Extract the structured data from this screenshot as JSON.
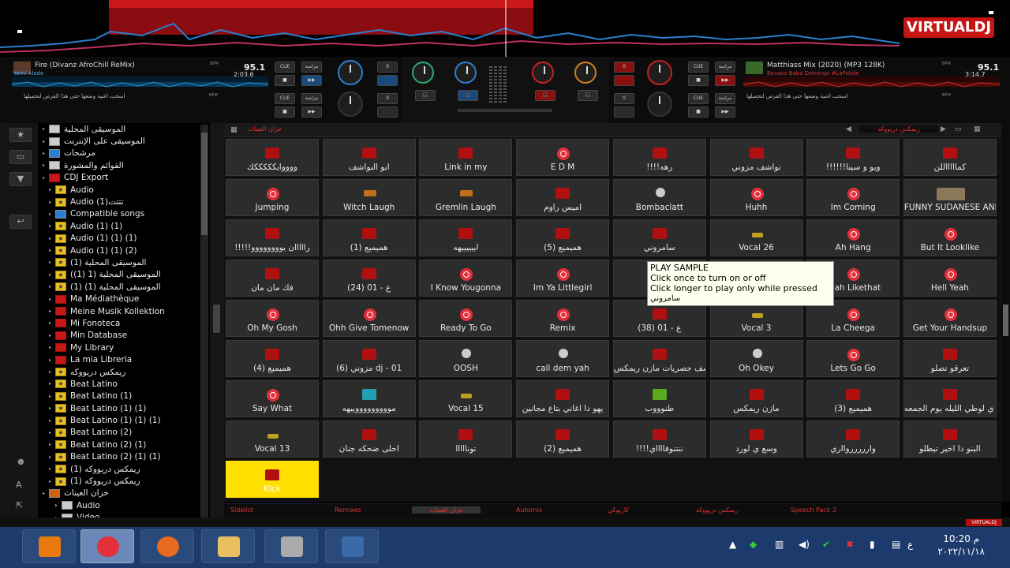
{
  "app": {
    "logo": "VIRTUALDJ",
    "logo_small": "VIRTUALDJ"
  },
  "deck_left": {
    "title": "Fire (Divanz AfroChill ReMix)",
    "artist": "Yemi Alade",
    "bpm": "95.1",
    "time": "2:03.6",
    "next_hint": "اسحب اغنية وضعها حتى هذا القرص لتحميلها",
    "bpm_label": "BPM"
  },
  "deck_right": {
    "title": "Matthiass Mix (2020) (MP3 128K)",
    "artist": "Bevaso Baba Domingo #LaPolide",
    "bpm": "95.1",
    "time": "3:14.7",
    "next_hint": "اسحب اغنية وضعها حتى هذا القرص لتحميلها",
    "bpm_label": "BPM"
  },
  "controls": {
    "cue": "CUE",
    "sync": "مزامنة",
    "pitch": "0"
  },
  "sidebar": {
    "items": [
      {
        "label": "الموسيقى المحلية",
        "icon": "gray"
      },
      {
        "label": "الموسيقى على الإنترنت",
        "icon": "gray"
      },
      {
        "label": "مرشحات",
        "icon": "blue"
      },
      {
        "label": "القوائم والمشورة",
        "icon": "gray"
      },
      {
        "label": "CDJ Export",
        "icon": "red"
      },
      {
        "label": "Audio",
        "icon": "star"
      },
      {
        "label": "Audio (1)تتتت",
        "icon": "star"
      },
      {
        "label": "Compatible songs",
        "icon": "blue"
      },
      {
        "label": "Audio (1) (1)",
        "icon": "star"
      },
      {
        "label": "Audio (1) (1) (1)",
        "icon": "star"
      },
      {
        "label": "Audio (1) (1) (2)",
        "icon": "star"
      },
      {
        "label": "(1) الموسيقى المحلية",
        "icon": "star"
      },
      {
        "label": "(الموسيقى المحلية (1 (1)",
        "icon": "star"
      },
      {
        "label": "(الموسيقى المحلية (1) (1",
        "icon": "star"
      },
      {
        "label": "Ma Médiathèque",
        "icon": "red"
      },
      {
        "label": "Meine Musik Kollektion",
        "icon": "red"
      },
      {
        "label": "Mi Fonoteca",
        "icon": "red"
      },
      {
        "label": "Min Database",
        "icon": "red"
      },
      {
        "label": "My Library",
        "icon": "red"
      },
      {
        "label": "La mia Libreria",
        "icon": "red"
      },
      {
        "label": "ريمكس دريووكه",
        "icon": "star"
      },
      {
        "label": "Beat Latino",
        "icon": "star"
      },
      {
        "label": "Beat Latino (1)",
        "icon": "star"
      },
      {
        "label": "Beat Latino (1) (1)",
        "icon": "star"
      },
      {
        "label": "Beat Latino (1) (1) (1)",
        "icon": "star"
      },
      {
        "label": "Beat Latino (2)",
        "icon": "star"
      },
      {
        "label": "Beat Latino (2) (1)",
        "icon": "star"
      },
      {
        "label": "Beat Latino (2) (1) (1)",
        "icon": "star"
      },
      {
        "label": "(1) ريمكس دريووكه",
        "icon": "star"
      },
      {
        "label": "(ريمكس دريووكه (1",
        "icon": "star"
      },
      {
        "label": "خزان العينات",
        "icon": "orange"
      },
      {
        "label": "Audio",
        "icon": "gray"
      },
      {
        "label": "Video",
        "icon": "gray"
      }
    ]
  },
  "sampler": {
    "header_title": "خزان العينات",
    "folder": "ريمكس دريووكه",
    "pads": [
      [
        "ووووايكككككك",
        "ابو النواشف",
        "Link in my",
        "E D M",
        "!!!!رهه",
        "نواشف مزوني",
        "!!!!!!ويو و سينا",
        "كماااااللن"
      ],
      [
        "Jumping",
        "Witch Laugh",
        "Gremlin Laugh",
        "اميس راوم",
        "Bombaclatt",
        "Huhh",
        "Im Coming",
        "FUNNY SUDANESE ANIMA..."
      ],
      [
        "!!!!!رااااان يوووووووو",
        "(1) هميميع",
        "اييييييهه",
        "(5) هميميع",
        "سامروني",
        "Vocal 26",
        "Ah Hang",
        "But It Looklike"
      ],
      [
        "فك مان مان",
        "(24) ع - 01",
        "I Know Yougonna",
        "Im Ya Littlegirl",
        "",
        "",
        "Yeah Likethat",
        "Hell Yeah"
      ],
      [
        "Oh My Gosh",
        "Ohh Give Tomenow",
        "Ready To Go",
        "Remix",
        "(38) ع - 01",
        "Vocal 3",
        "La Cheega",
        "Get Your Handsup"
      ],
      [
        "(4) هميميع",
        "(6) مزوني dj - 01",
        "OOSH",
        "call dem yah",
        "نواشف حصريات مازن ريمكس",
        "Oh Okey",
        "Lets Go Go",
        "تعرقو تصلو"
      ],
      [
        "Say What",
        "موووووووووييهه",
        "Vocal 15",
        "يهو دا اغاني بتاع مجانين",
        "طنوووب",
        "مازن ريمكس",
        "(3) هميميع",
        "أمشي ي لوطي الليله يوم الجمعه"
      ],
      [
        "Vocal 13",
        "احلى ضحكه جنان",
        "تونااااا",
        "(2) هميميع",
        "!!!!ننتنوفااااي",
        "وسع ي لورد",
        "واررررروااري",
        "البنو دا اخير تيطلو"
      ],
      [
        "Kick"
      ]
    ],
    "icons": [
      [
        "flag",
        "flag",
        "flag",
        "target",
        "flag",
        "flag",
        "flag",
        "flag"
      ],
      [
        "target",
        "orange",
        "orange",
        "flag",
        "gray",
        "target",
        "target",
        "photo"
      ],
      [
        "flag",
        "flag",
        "flag",
        "flag",
        "flag",
        "star",
        "target",
        "target"
      ],
      [
        "flag",
        "flag",
        "target",
        "target",
        "",
        "",
        "target",
        "target"
      ],
      [
        "target",
        "target",
        "target",
        "target",
        "flag",
        "star",
        "target",
        "target"
      ],
      [
        "flag",
        "flag",
        "gray",
        "gray",
        "flag",
        "gray",
        "target",
        "flag"
      ],
      [
        "target",
        "teal",
        "star",
        "flag",
        "green",
        "flag",
        "flag",
        "flag"
      ],
      [
        "star",
        "flag",
        "flag",
        "flag",
        "flag",
        "flag",
        "flag",
        "flag"
      ],
      [
        "flag"
      ]
    ]
  },
  "tooltip": {
    "title": "PLAY SAMPLE",
    "line1": "Click once to turn on or off",
    "line2": "Click longer to play only while pressed",
    "name": "سامروني"
  },
  "bottom_tabs": [
    "Sidelist",
    "Remixes",
    "خزان العينات",
    "Automix",
    "كاريوكي",
    "ريمكس دريووكه",
    "Speech Pack 2"
  ],
  "taskbar": {
    "time": "10:20 م",
    "date": "٢٠٢٢/١١/١٨",
    "lang": "ع"
  }
}
